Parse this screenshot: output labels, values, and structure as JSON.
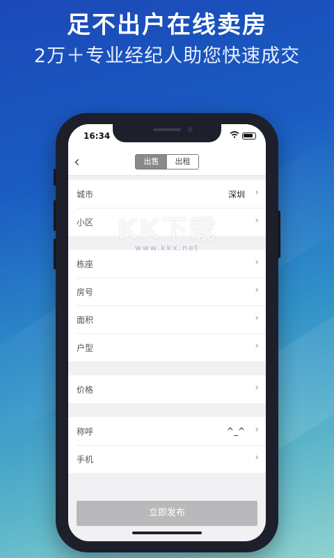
{
  "promo": {
    "headline": "足不出户在线卖房",
    "subline": "2万＋专业经纪人助您快速成交"
  },
  "status_bar": {
    "time": "16:34"
  },
  "nav": {
    "tabs": [
      {
        "label": "出售",
        "active": true
      },
      {
        "label": "出租",
        "active": false
      }
    ]
  },
  "form": {
    "groups": [
      [
        {
          "label": "城市",
          "value": "深圳"
        },
        {
          "label": "小区",
          "value": ""
        }
      ],
      [
        {
          "label": "栋座",
          "value": ""
        },
        {
          "label": "房号",
          "value": ""
        },
        {
          "label": "面积",
          "value": ""
        },
        {
          "label": "户型",
          "value": ""
        }
      ],
      [
        {
          "label": "价格",
          "value": ""
        }
      ],
      [
        {
          "label": "称呼",
          "value": "^_^"
        },
        {
          "label": "手机",
          "value": ""
        }
      ]
    ]
  },
  "publish_label": "立即发布",
  "watermark": {
    "main": "KK下载",
    "sub": "www.kkx.net"
  },
  "colors": {
    "tab_active": "#8a8a8a",
    "button_disabled": "#b9b9bb"
  }
}
